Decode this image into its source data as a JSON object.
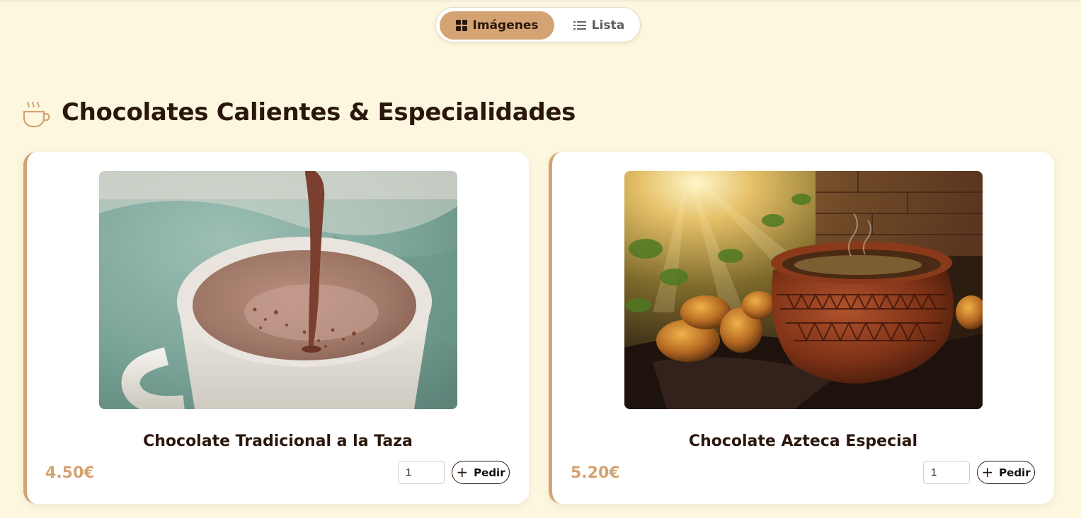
{
  "view_toggle": {
    "images_label": "Imágenes",
    "list_label": "Lista",
    "active": "images"
  },
  "section": {
    "icon": "coffee-cup-icon",
    "title": "Chocolates Calientes & Especialidades"
  },
  "products": [
    {
      "name": "Chocolate Tradicional a la Taza",
      "price": "4.50€",
      "quantity": "1",
      "order_label": "Pedir"
    },
    {
      "name": "Chocolate Azteca Especial",
      "price": "5.20€",
      "quantity": "1",
      "order_label": "Pedir"
    }
  ],
  "colors": {
    "background": "#fdf7df",
    "accent": "#d4a373",
    "text_dark": "#2a170c"
  }
}
